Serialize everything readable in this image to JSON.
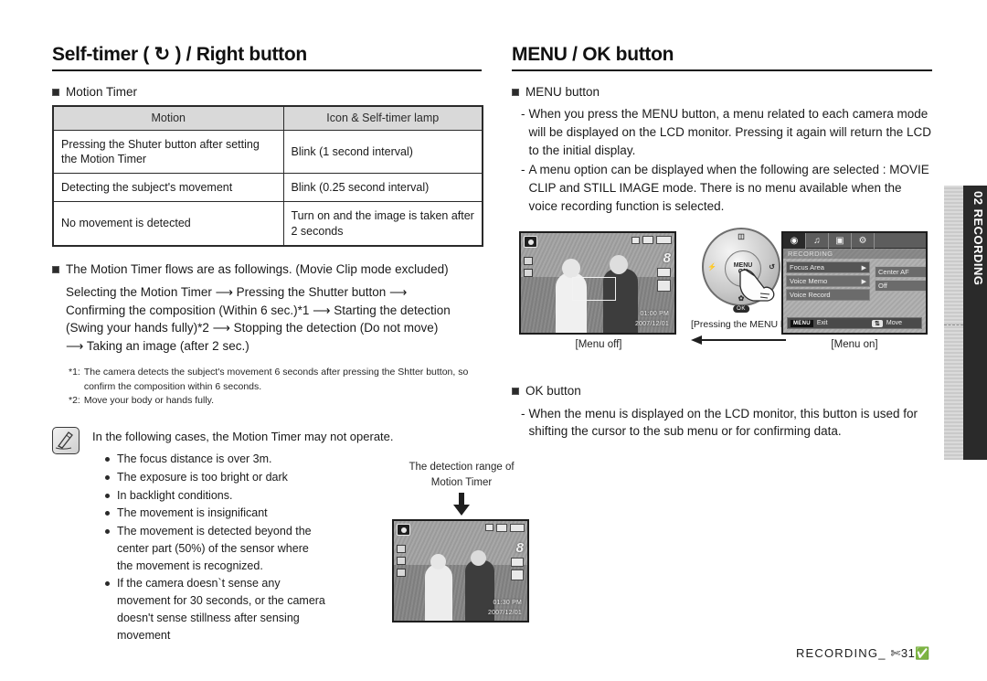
{
  "left": {
    "title": "Self-timer ( ↻ ) / Right button",
    "motion_timer_heading": "Motion Timer",
    "table": {
      "headers": [
        "Motion",
        "Icon & Self-timer lamp"
      ],
      "rows": [
        [
          "Pressing the Shuter button after setting the Motion Timer",
          "Blink (1 second interval)"
        ],
        [
          "Detecting the subject's movement",
          "Blink (0.25 second interval)"
        ],
        [
          "No movement is detected",
          "Turn on and the image is taken after 2 seconds"
        ]
      ]
    },
    "flow_heading": "The Motion Timer flows are as followings. (Movie Clip mode excluded)",
    "flow_lines": [
      "Selecting the Motion Timer ⟶ Pressing the Shutter button ⟶",
      "Confirming the composition (Within 6 sec.)*1 ⟶ Starting the detection",
      "(Swing your hands fully)*2 ⟶ Stopping the detection (Do not move)",
      "⟶ Taking an image (after 2 sec.)"
    ],
    "footnotes": [
      {
        "key": "*1:",
        "text": "The camera detects the subject's movement 6 seconds after pressing the Shtter button, so confirm the composition within 6 seconds."
      },
      {
        "key": "*2:",
        "text": "Move your body or hands fully."
      }
    ],
    "note_icon": "pencil-note-icon",
    "note_intro": "In the following cases, the Motion Timer may not operate.",
    "note_items": [
      "The focus distance is over 3m.",
      "The exposure is too bright or dark",
      "In backlight conditions.",
      "The movement is insignificant",
      "The movement is detected beyond the center part (50%) of the sensor where the movement is recognized.",
      "If the camera doesn`t sense any movement for 30 seconds, or the camera doesn't sense stillness after sensing movement"
    ],
    "detection_figure": {
      "caption_line1": "The detection range of",
      "caption_line2": "Motion Timer",
      "lcd_time": "01:30 PM",
      "lcd_date": "2007/12/01",
      "lcd_counter": "8"
    }
  },
  "right": {
    "title": "MENU / OK button",
    "menu_button_heading": "MENU button",
    "menu_button_items": [
      "When you press the MENU button, a menu related to each camera mode will be displayed on the LCD monitor. Pressing it again will return the LCD to the initial display.",
      "A menu option can be displayed when the following are selected : MOVIE CLIP and STILL IMAGE mode. There is no menu available when the voice recording function is selected."
    ],
    "figures": {
      "menu_off_caption": "[Menu off]",
      "menu_on_caption": "[Menu on]",
      "press_caption": "[Pressing the MENU button]",
      "lcd_off": {
        "time": "01:00 PM",
        "date": "2007/12/01",
        "counter": "8"
      },
      "dial": {
        "center_line1": "MENU",
        "center_line2": "OK",
        "top_label": "display-icon",
        "bottom_label": "macro-icon",
        "left_label": "flash-icon",
        "right_label": "self-timer-icon",
        "badge": "OK"
      },
      "menu_on": {
        "tabs": [
          "camera-tab-icon",
          "sound-tab-icon",
          "display-tab-icon",
          "setup-tab-icon"
        ],
        "title": "RECORDING",
        "rows": [
          {
            "label": "Focus Area",
            "arrow": "▶"
          },
          {
            "label": "Voice Memo",
            "arrow": "▶"
          },
          {
            "label": "Voice Record",
            "arrow": ""
          }
        ],
        "sub_rows": [
          "Center AF",
          "Off"
        ],
        "bottom_exit_key": "MENU",
        "bottom_exit_label": "Exit",
        "bottom_move_key": "⇅",
        "bottom_move_label": "Move"
      }
    },
    "ok_button_heading": "OK button",
    "ok_button_items": [
      "When the menu is displayed on the LCD monitor, this button is used for shifting the cursor to the sub menu or for confirming data."
    ]
  },
  "side_tab": {
    "label": "02 RECORDING"
  },
  "footer": {
    "section": "RECORDING_",
    "page": "✄31✅"
  },
  "colors": {
    "ink": "#1a1a1a",
    "table_header_bg": "#d9d9d9",
    "side_tab_dark": "#2a2a2a"
  }
}
